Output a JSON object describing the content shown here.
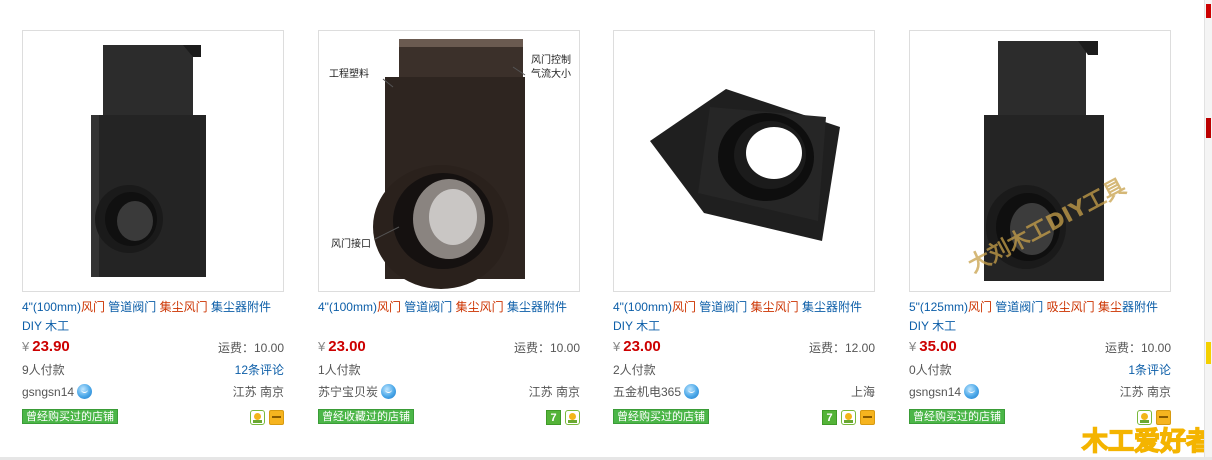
{
  "products": [
    {
      "image_alt": "4-inch black blast gate valve",
      "title": {
        "prefix": "4\"(100mm)",
        "kw1": "风门",
        "mid1": " 管道阀门 ",
        "kw2": "集尘风门",
        "mid2": " 集尘器附件",
        "line2": "DIY 木工"
      },
      "price": "23.90",
      "shipping": "运费：10.00",
      "sales": "9人付款",
      "reviews": "12条评论",
      "seller": "gsngsn14",
      "location": "江苏 南京",
      "shop_tag": "曾经购买过的店铺",
      "icons": [
        "seal-icon",
        "card-icon"
      ]
    },
    {
      "image_alt": "4-inch brown blast gate valve with labels",
      "image_labels": {
        "a": "风门控制",
        "b": "气流大小",
        "c": "工程塑料",
        "d": "风门接口"
      },
      "title": {
        "prefix": "4\"(100mm)",
        "kw1": "风门",
        "mid1": " 管道阀门 ",
        "kw2": "集尘风门",
        "mid2": " 集尘器附件",
        "line2": ""
      },
      "price": "23.00",
      "shipping": "运费：10.00",
      "sales": "1人付款",
      "reviews": "",
      "seller": "苏宁宝贝炭",
      "location": "江苏 南京",
      "shop_tag": "曾经收藏过的店铺",
      "icons": [
        "seven-day-icon",
        "seal-icon"
      ]
    },
    {
      "image_alt": "4-inch black blast gate valve angled view",
      "title": {
        "prefix": "4\"(100mm)",
        "kw1": "风门",
        "mid1": " 管道阀门 ",
        "kw2": "集尘风门",
        "mid2": " 集尘器附件",
        "line2": "DIY 木工"
      },
      "price": "23.00",
      "shipping": "运费：12.00",
      "sales": "2人付款",
      "reviews": "",
      "seller": "五金机电365",
      "location": "上海",
      "shop_tag": "曾经购买过的店铺",
      "icons": [
        "seven-day-icon",
        "seal-icon",
        "card-icon"
      ]
    },
    {
      "image_alt": "5-inch black blast gate valve with watermark",
      "watermark": "大刘木工DIY工具",
      "title": {
        "prefix": "5\"(125mm)",
        "kw1": "风门",
        "mid1": " 管道阀门 ",
        "kw2": "吸尘风门",
        "mid2": " ",
        "kw3": "集尘",
        "mid3": "器附件",
        "line2": "DIY 木工"
      },
      "price": "35.00",
      "shipping": "运费：10.00",
      "sales": "0人付款",
      "reviews": "1条评论",
      "seller": "gsngsn14",
      "location": "江苏 南京",
      "shop_tag": "曾经购买过的店铺",
      "icons": [
        "seal-icon",
        "card-icon"
      ]
    }
  ],
  "currency_symbol": "¥",
  "logo": {
    "text": "木工爱好者"
  },
  "colors": {
    "link": "#0c5ea8",
    "keyword": "#cc3300",
    "price": "#cc0000",
    "shop_tag": "#4bb648"
  }
}
